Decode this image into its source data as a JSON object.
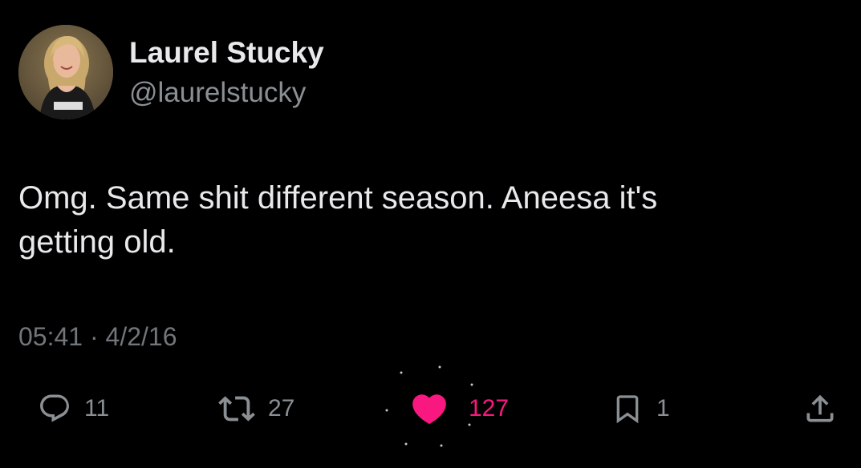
{
  "author": {
    "display_name": "Laurel Stucky",
    "handle": "@laurelstucky"
  },
  "tweet": {
    "text_line1": "Omg. Same shit different season. Aneesa it's",
    "text_line2": "getting old.",
    "timestamp": "05:41 · 4/2/16"
  },
  "actions": {
    "reply": {
      "icon": "reply-icon",
      "count": "11"
    },
    "retweet": {
      "icon": "retweet-icon",
      "count": "27"
    },
    "like": {
      "icon": "heart-icon",
      "count": "127",
      "liked": true
    },
    "bookmark": {
      "icon": "bookmark-icon",
      "count": "1"
    },
    "share": {
      "icon": "share-icon"
    }
  },
  "colors": {
    "background": "#000000",
    "primary_text": "#e7e9ea",
    "secondary_text": "#71767b",
    "like_accent": "#f91880"
  }
}
